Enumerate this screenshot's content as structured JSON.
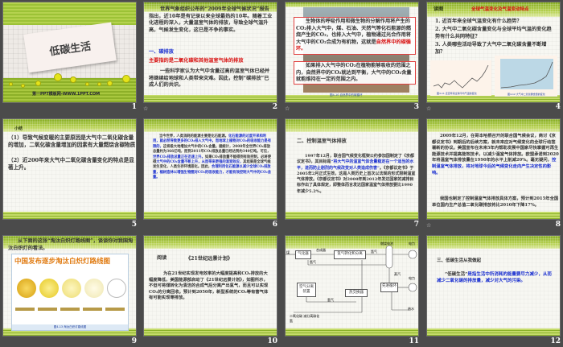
{
  "slides": [
    {
      "number": "1",
      "title": "低碳生活",
      "footer": "第一PPT模板网-WWW.1PPT.COM"
    },
    {
      "number": "2",
      "p1": "世界气象组织公布的“2009年全球气候状况”报告指出，近10年是有记录以来全球最热的10年。随着工业化进程的深入，大量温室气体的排放，导致全球气温升高，气候发生变化，这已是不争的事实。",
      "heading": "一、碳排放",
      "red": "主要指的是二氧化碳和其他温室气体的排放",
      "p2": "一些科学家认为大气中含量过高的温室气体已经并将继续给地球和人类带来灾难。因此，控制“碳排放”已成人们的共识。"
    },
    {
      "number": "3",
      "box1": "生物体的呼吸作用和微生物的分解作用将产生的CO₂排入大气中，煤、石油、天然气等化石能源的燃烧产生的CO₂，也排入大气中，植物通过光合作用将大气中的CO₂合成为有机物，这就是",
      "box1_red": "自然界中的碳循环。",
      "box2": "如果排入大气中的CO₂在植物能够吸收的范围之内，自然界中的CO₂就达到平衡，大气中的CO₂含量就能维持在一定的范围之内。",
      "caption": "图4-10  自然界中的碳循环"
    },
    {
      "number": "4",
      "label": "读图",
      "title": "全球气温变化及气温变动特点",
      "q1": "1. 近百年来全球气温变化有什么趋势？",
      "q2": "2. 大气中二氧化碳含量变化与全球平均气温的变化趋势有什么共同特征？",
      "q3": "3. 人类哪些活动导致了大气中二氧化碳含量不断增加？",
      "chart1_caption": "图4-11  近百年来全球平均气温的变化",
      "chart2_caption": "图4-12  大气中二氧化碳含量的变化"
    },
    {
      "number": "5",
      "title": "小结",
      "p1": "（1）导致气候变暖的主要原因是大气中二氧化碳含量的增加，二氧化碳含量增加的因素有大量燃烧含碳物质",
      "p2": "（2）近200年来大气中二氧化碳含量变化的特点是显著上升。"
    },
    {
      "number": "6",
      "a": "当今世界，人类消耗的能源主要是化石能源。",
      "b": "化石能源的过度开采和利用，就必然导致更多的CO₂排入大气中。而地球上植物对CO₂的吸收能力是有限的，",
      "c": "这将极大地增加大气中的CO₂含量。据统计，2008年全世界CO₂排放总量约为366亿吨，而到2011年CO₂排放总量已经达到约340亿吨。可见，",
      "d": "世界CO₂排放总量正在迅速上升。",
      "e": "如果CO₂排放量不能得到有效控制，必将使得",
      "f": "大气中的CO₂含量不断上升，从而带来更强的温室效应，",
      "g": "其结果是全球气候发生变化，人类生存环境恶化。因此，",
      "h": "合理利用化石能源以减少全球CO₂排放量，植树造林以增强生物圈对CO₂的吸收能力，才能有效控制大气中的CO₂含量。"
    },
    {
      "number": "7",
      "title": "二、控制温室气体排放",
      "a": "1997年12月，联合国气候变化框架公约参加国制定了《京都议定书》，其目标是",
      "b": "“将大气中的温室气体含量稳定在一个适当的水平，进而防止剧烈的气候改变对人类造成伤害”",
      "c": "。《京都议定书》于2005年2月正式生效，这是人类历史上首次以法规的形式限制温室气体排放。《京都议定书》对2008年到2012年发达国家的减排目标作出了具体规定，即整体而言发达国家温室气体排放要比1990年减少5.2%。"
    },
    {
      "number": "8",
      "a": "2009年12月，在哥本哈根召开的联合国气候会议，商讨《京都议定书》到期后的后续方案，就未来应对气候变化的全球行动签署新的协议。美国宣布在未来5年内帮助发展中国家尽快掌握可再生能源技术并提高能效技术，以减少温室气体排放。欧盟承诺到2020年将温室气体排放量在1990年的水平上削减20%。毫无疑问，",
      "b": "控制温室气体排放，将对地球今后的气候变化走向产生决定性的影响。",
      "c": "我国也制定了控制温室气体排放具体方案，预计到2015年全国单位国内生产总值二氧化碳排放将比2010年下降17%。"
    },
    {
      "number": "9",
      "intro": "从下面的这张“淘汰白炽灯路线图”，谈谈你对我国淘汰白炽灯的看法。",
      "poster_title": "中国发布逐步淘汰白炽灯路线图",
      "caption": "图4-13  淘汰白炽灯路线图"
    },
    {
      "number": "10",
      "label": "阅读",
      "title": "《21世纪远景计划》",
      "body": "为在21世纪实现发电效率的大幅度提高和CO₂排放的大幅度降低，美国能源部启动了《21世纪远景计划》，如图所示，不但可将煤转化为清洁的合成气后分离产出氢气，而且可以实现CO₂的分离回收。预计到2050年，新型系统的CO₂等有害气体有可能实现零排放。"
    },
    {
      "number": "11",
      "nodes": [
        "气化器",
        "合成器",
        "氢气转化和分离",
        "燃烧电池",
        "电力",
        "空气分离装置",
        "热交换器",
        "先进循环",
        "氢气",
        "氢气",
        "氢气",
        "蒸汽",
        "电力",
        "热水",
        "二氧化碳 减分离碳化氢",
        "煤"
      ]
    },
    {
      "number": "12",
      "title": "三、低碳生活从我做起",
      "a": "“低碳生活”",
      "b": "是指生活中所消耗的能量要尽力减少，从而减少二氧化碳的排放量，减少对大气的污染。"
    }
  ],
  "animation_icon": "☆"
}
